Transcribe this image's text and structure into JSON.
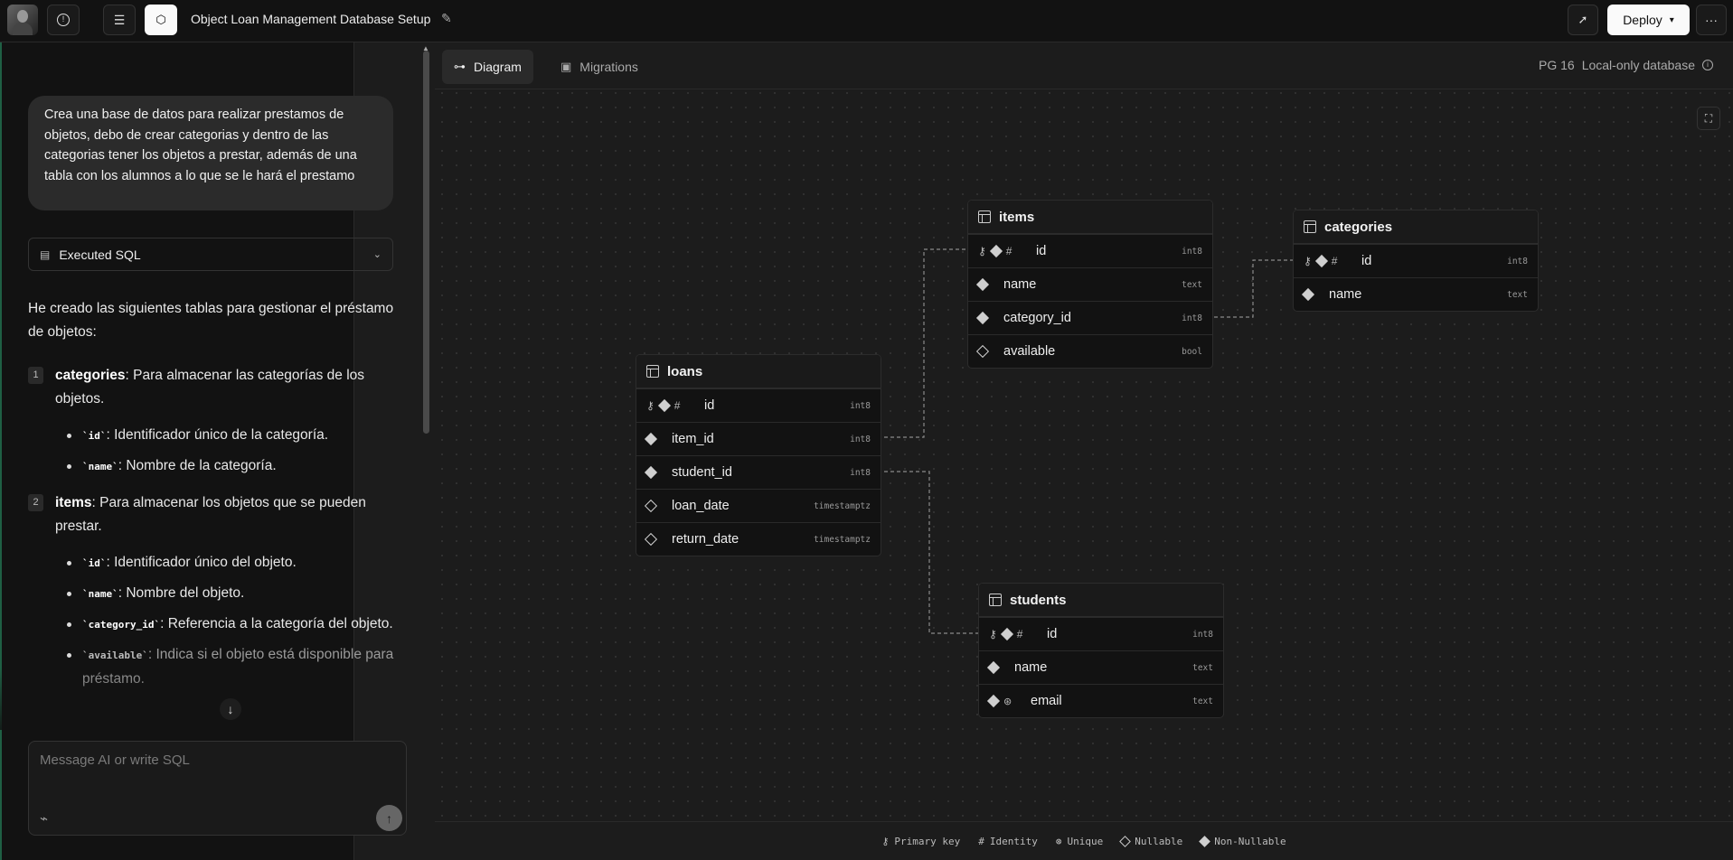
{
  "topbar": {
    "project_title": "Object Loan Management Database Setup",
    "deploy_label": "Deploy",
    "more_label": "···"
  },
  "chat": {
    "user_message": "Crea una base de datos para realizar prestamos de objetos, debo de crear categorias y dentro de las categorias tener los objetos a prestar, además de una tabla con los alumnos a lo que se le hará el prestamo",
    "executed_sql_label": "Executed SQL",
    "intro": "He creado las siguientes tablas para gestionar el préstamo de objetos:",
    "sections": [
      {
        "num": "1",
        "title": "categories",
        "desc": ": Para almacenar las categorías de los objetos.",
        "items": [
          {
            "code": "`id`",
            "text": ": Identificador único de la categoría."
          },
          {
            "code": "`name`",
            "text": ": Nombre de la categoría."
          }
        ]
      },
      {
        "num": "2",
        "title": "items",
        "desc": ": Para almacenar los objetos que se pueden prestar.",
        "items": [
          {
            "code": "`id`",
            "text": ": Identificador único del objeto."
          },
          {
            "code": "`name`",
            "text": ": Nombre del objeto."
          },
          {
            "code": "`category_id`",
            "text": ": Referencia a la categoría del objeto."
          },
          {
            "code": "`available`",
            "text": ": Indica si el objeto está disponible para préstamo."
          }
        ]
      }
    ],
    "composer_placeholder": "Message AI or write SQL"
  },
  "canvas": {
    "tabs": [
      {
        "label": "Diagram",
        "icon": "diagram-icon",
        "active": true
      },
      {
        "label": "Migrations",
        "icon": "migrations-icon",
        "active": false
      }
    ],
    "pg_version": "PG 16",
    "db_mode": "Local-only database"
  },
  "tables": {
    "items": {
      "name": "items",
      "columns": [
        {
          "name": "id",
          "type": "int8",
          "flags": [
            "primary-key",
            "non-nullable",
            "identity"
          ]
        },
        {
          "name": "name",
          "type": "text",
          "flags": [
            "non-nullable"
          ]
        },
        {
          "name": "category_id",
          "type": "int8",
          "flags": [
            "non-nullable"
          ]
        },
        {
          "name": "available",
          "type": "bool",
          "flags": [
            "nullable"
          ]
        }
      ]
    },
    "categories": {
      "name": "categories",
      "columns": [
        {
          "name": "id",
          "type": "int8",
          "flags": [
            "primary-key",
            "non-nullable",
            "identity"
          ]
        },
        {
          "name": "name",
          "type": "text",
          "flags": [
            "non-nullable"
          ]
        }
      ]
    },
    "loans": {
      "name": "loans",
      "columns": [
        {
          "name": "id",
          "type": "int8",
          "flags": [
            "primary-key",
            "non-nullable",
            "identity"
          ]
        },
        {
          "name": "item_id",
          "type": "int8",
          "flags": [
            "non-nullable"
          ]
        },
        {
          "name": "student_id",
          "type": "int8",
          "flags": [
            "non-nullable"
          ]
        },
        {
          "name": "loan_date",
          "type": "timestamptz",
          "flags": [
            "nullable"
          ]
        },
        {
          "name": "return_date",
          "type": "timestamptz",
          "flags": [
            "nullable"
          ]
        }
      ]
    },
    "students": {
      "name": "students",
      "columns": [
        {
          "name": "id",
          "type": "int8",
          "flags": [
            "primary-key",
            "non-nullable",
            "identity"
          ]
        },
        {
          "name": "name",
          "type": "text",
          "flags": [
            "non-nullable"
          ]
        },
        {
          "name": "email",
          "type": "text",
          "flags": [
            "non-nullable",
            "unique"
          ]
        }
      ]
    }
  },
  "legend": {
    "primary_key": "Primary key",
    "identity": "Identity",
    "unique": "Unique",
    "nullable": "Nullable",
    "non_nullable": "Non-Nullable"
  },
  "colors": {
    "background": "#1c1c1c",
    "panel": "#121212",
    "accent_green": "#1f5f44"
  }
}
